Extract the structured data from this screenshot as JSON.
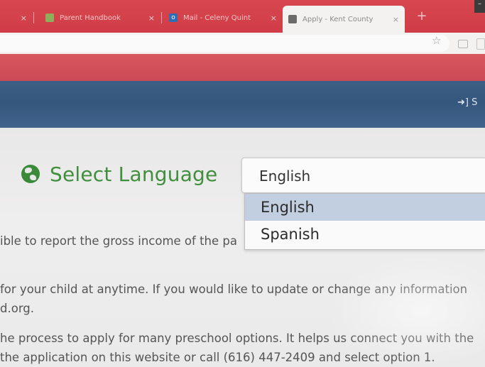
{
  "browser": {
    "tabs": [
      {
        "title": "",
        "close": "×",
        "favicon_color": "#e07a7f"
      },
      {
        "title": "Parent Handbook",
        "close": "×",
        "favicon_color": "#8fae5a"
      },
      {
        "title": "Mail - Celeny Quint",
        "close": "×",
        "favicon_color": "#2f6db5",
        "favicon_text": "o"
      },
      {
        "title": "Apply - Kent County",
        "close": "×",
        "favicon_color": "#6b6b6b",
        "active": true
      }
    ],
    "new_tab": "+",
    "star_icon": "☆",
    "window_control": "–"
  },
  "site": {
    "sign_in": "➜] S"
  },
  "language": {
    "title": "Select Language",
    "selected": "English",
    "options": [
      "English",
      "Spanish"
    ]
  },
  "body_text": {
    "line1": "ible to report the gross income of the pa",
    "line2": "for your child at anytime. If you would like to update or change any information",
    "line3": "d.org.",
    "line4": "he process to apply for many preschool options. It helps us connect you with the",
    "line5": "the application on this website or call (616) 447-2409 and select option 1."
  },
  "colors": {
    "tabbar": "#cf3c47",
    "header": "#3d5f86",
    "accent_green": "#3f8f3d",
    "option_highlight": "#c2cfe0"
  }
}
